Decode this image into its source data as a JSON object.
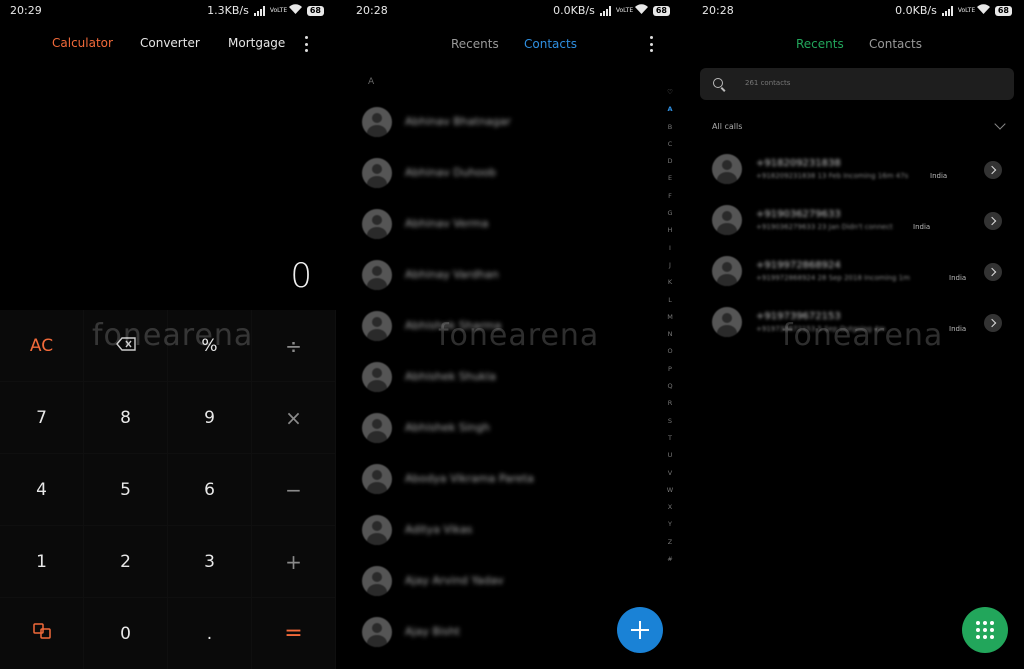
{
  "calculator": {
    "status": {
      "time": "20:29",
      "speed": "1.3KB/s",
      "volte": "VoLTE",
      "battery": "68"
    },
    "tabs": [
      "Calculator",
      "Converter",
      "Mortgage"
    ],
    "display": "0",
    "keys": [
      "AC",
      "",
      "%",
      "÷",
      "7",
      "8",
      "9",
      "×",
      "4",
      "5",
      "6",
      "−",
      "1",
      "2",
      "3",
      "+",
      "",
      "0",
      ".",
      "="
    ],
    "watermark": "fonearena",
    "accent": "#f26a3a"
  },
  "contacts": {
    "status": {
      "time": "20:28",
      "speed": "0.0KB/s",
      "volte": "VoLTE",
      "battery": "68"
    },
    "tabs": [
      "Recents",
      "Contacts"
    ],
    "section": "A",
    "names": [
      "Abhinav Bhatnagar",
      "Abhinav Duhoob",
      "Abhinav Verma",
      "Abhinay Vardhan",
      "Abhishek Sharma",
      "Abhishek Shukla",
      "Abhishek Singh",
      "Abodya Vikrama Pareta",
      "Aditya Vikas",
      "Ajay Arvind Yadav",
      "Ajay Bisht"
    ],
    "alphabet": [
      "♡",
      "A",
      "B",
      "C",
      "D",
      "E",
      "F",
      "G",
      "H",
      "I",
      "J",
      "K",
      "L",
      "M",
      "N",
      "O",
      "P",
      "Q",
      "R",
      "S",
      "T",
      "U",
      "V",
      "W",
      "X",
      "Y",
      "Z",
      "#"
    ],
    "watermark": "fonearena",
    "accent": "#2f8fe0"
  },
  "recents": {
    "status": {
      "time": "20:28",
      "speed": "0.0KB/s",
      "volte": "VoLTE",
      "battery": "68"
    },
    "tabs": [
      "Recents",
      "Contacts"
    ],
    "search_placeholder": "261 contacts",
    "all_calls": "All calls",
    "calls": [
      {
        "number": "+918209231838",
        "detail": "+918209231838 13 Feb Incoming 16m 47s",
        "location": "India"
      },
      {
        "number": "+919036279633",
        "detail": "+919036279633 23 Jan Didn't connect",
        "location": "India"
      },
      {
        "number": "+919972868924",
        "detail": "+919972868924 28 Sep 2018 Incoming 1m",
        "location": "India"
      },
      {
        "number": "+919739672153",
        "detail": "+919739672153 5 Sep Outgoing 4m",
        "location": "India"
      }
    ],
    "watermark": "fonearena",
    "accent": "#22a65b"
  }
}
